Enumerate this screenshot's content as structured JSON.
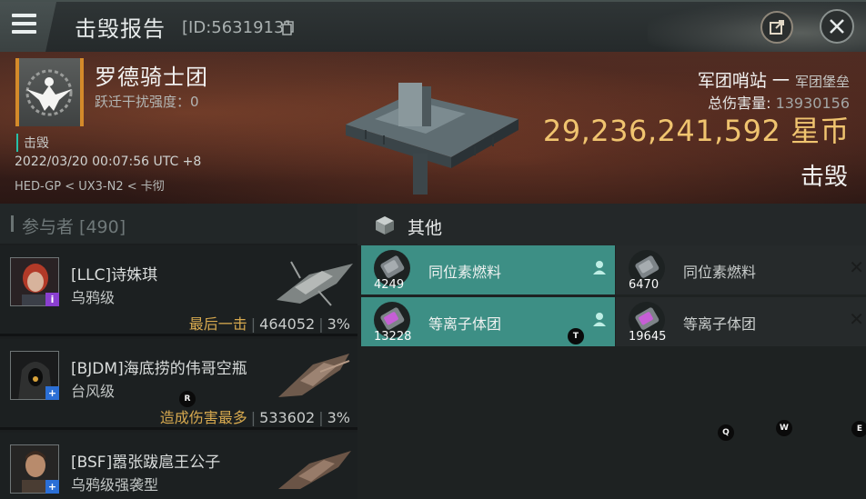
{
  "topbar": {
    "title": "击毁报告",
    "kill_id": "[ID:5631913]"
  },
  "victim": {
    "corp_name": "罗德骑士团",
    "warp_label": "跃迁干扰强度：",
    "warp_value": "0",
    "status_tag": "击毁",
    "datetime": "2022/03/20 00:07:56 UTC +8",
    "location": "HED-GP < UX3-N2 < 卡彻",
    "ship_type": "军团哨站",
    "ship_dash": "一",
    "ship_sub": "军团堡垒",
    "total_damage_label": "总伤害量:",
    "total_damage_value": "13930156",
    "isk_value": "29,236,241,592",
    "isk_unit": "星币",
    "result": "击毁"
  },
  "participants": {
    "header": "参与者 [490]",
    "list": [
      {
        "name": "[LLC]诗姝琪",
        "ship": "乌鸦级",
        "tag": "最后一击",
        "damage": "464052",
        "percent": "3%",
        "badge": "i",
        "badge_color": "#8a3fd0"
      },
      {
        "name": "[BJDM]海底捞的伟哥空瓶",
        "ship": "台风级",
        "tag": "造成伤害最多",
        "damage": "533602",
        "percent": "3%",
        "badge": "+",
        "badge_color": "#2b6fd6"
      },
      {
        "name": "[BSF]嚣张跋扈王公子",
        "ship": "乌鸦级强袭型",
        "tag": "",
        "damage": "",
        "percent": "",
        "badge": "+",
        "badge_color": "#2b6fd6"
      }
    ]
  },
  "other": {
    "header": "其他",
    "items": [
      {
        "name": "同位素燃料",
        "qty": "4249",
        "state": "dropped",
        "icon": "fuel-canister-icon"
      },
      {
        "name": "同位素燃料",
        "qty": "6470",
        "state": "destroyed",
        "icon": "fuel-canister-icon"
      },
      {
        "name": "等离子体团",
        "qty": "13228",
        "state": "dropped",
        "icon": "plasma-canister-icon"
      },
      {
        "name": "等离子体团",
        "qty": "19645",
        "state": "destroyed",
        "icon": "plasma-canister-icon"
      }
    ]
  },
  "hints": [
    "T",
    "R",
    "Q",
    "W",
    "E"
  ],
  "colors": {
    "accent_teal": "#3d8f85",
    "isk_gold": "#f0c46f",
    "tag_gold": "#d7a94f",
    "logo_orange": "#d48a2a"
  }
}
